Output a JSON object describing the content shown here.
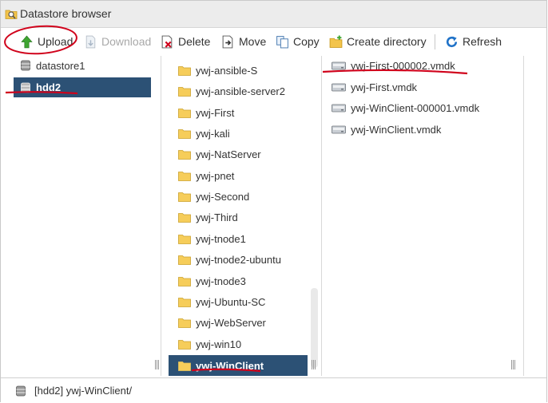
{
  "window": {
    "title": "Datastore browser"
  },
  "toolbar": {
    "upload": "Upload",
    "download": "Download",
    "delete": "Delete",
    "move": "Move",
    "copy": "Copy",
    "create_directory": "Create directory",
    "refresh": "Refresh"
  },
  "datastores": [
    {
      "label": "datastore1",
      "selected": false
    },
    {
      "label": "hdd2",
      "selected": true
    }
  ],
  "folders": [
    "ywj-ansible-S",
    "ywj-ansible-server2",
    "ywj-First",
    "ywj-kali",
    "ywj-NatServer",
    "ywj-pnet",
    "ywj-Second",
    "ywj-Third",
    "ywj-tnode1",
    "ywj-tnode2-ubuntu",
    "ywj-tnode3",
    "ywj-Ubuntu-SC",
    "ywj-WebServer",
    "ywj-win10",
    "ywj-WinClient"
  ],
  "selected_folder": "ywj-WinClient",
  "files": [
    "ywj-First-000002.vmdk",
    "ywj-First.vmdk",
    "ywj-WinClient-000001.vmdk",
    "ywj-WinClient.vmdk"
  ],
  "status": {
    "path": "[hdd2] ywj-WinClient/"
  },
  "colors": {
    "selection": "#2c5175",
    "annotation": "#d0021b",
    "upload_arrow": "#3ea531",
    "refresh": "#1f72c8"
  },
  "icons": {
    "title": "search-folder-icon",
    "datastore": "database-icon",
    "folder": "folder-icon",
    "file": "disk-file-icon"
  }
}
